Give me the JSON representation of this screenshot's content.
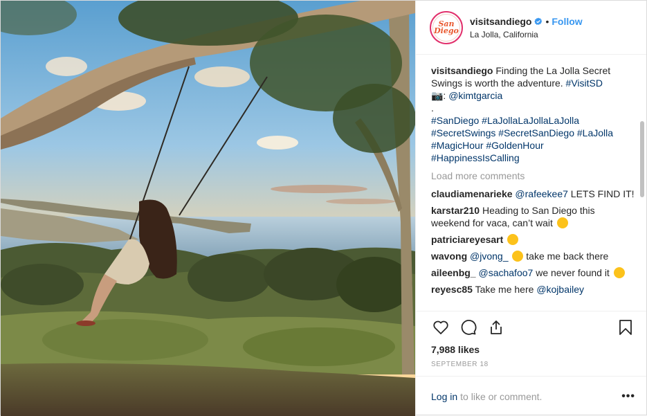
{
  "header": {
    "username": "visitsandiego",
    "separator": "•",
    "follow_label": "Follow",
    "location": "La Jolla, California",
    "avatar_text": "San Diego"
  },
  "caption": {
    "username": "visitsandiego",
    "text": "Finding the La Jolla Secret Swings is worth the adventure.",
    "hashtag_main": "#VisitSD",
    "camera_prefix": "📷:",
    "credit": "@kimtgarcia",
    "dot": ".",
    "hashtags_line1": "#SanDiego #LaJollaLaJollaLaJolla",
    "hashtags_line2": "#SecretSwings #SecretSanDiego #LaJolla",
    "hashtags_line3": "#MagicHour #GoldenHour",
    "hashtags_line4": "#HappinessIsCalling"
  },
  "load_more": "Load more comments",
  "comments": [
    {
      "user": "claudiamenarieke",
      "mention": "@rafeekee7",
      "text": "LETS FIND IT!"
    },
    {
      "user": "karstar210",
      "text": "Heading to San Diego this weekend for vaca, can’t wait"
    },
    {
      "user": "patriciareyesart",
      "text": ""
    },
    {
      "user": "wavong",
      "mention": "@jvong_",
      "text": "take me back there"
    },
    {
      "user": "aileenbg_",
      "mention": "@sachafoo7",
      "text": "we never found it"
    },
    {
      "user": "reyesc85",
      "text": "Take me here",
      "mention": "@kojbailey"
    }
  ],
  "likes": "7,988 likes",
  "date": "September 18",
  "login": {
    "link": "Log in",
    "text": "to like or comment.",
    "more": "•••"
  },
  "icons": [
    "heart-icon",
    "comment-icon",
    "share-icon",
    "bookmark-icon",
    "verified-icon"
  ],
  "colors": {
    "follow": "#3897f0",
    "link": "#003569",
    "verified": "#3897f0"
  }
}
